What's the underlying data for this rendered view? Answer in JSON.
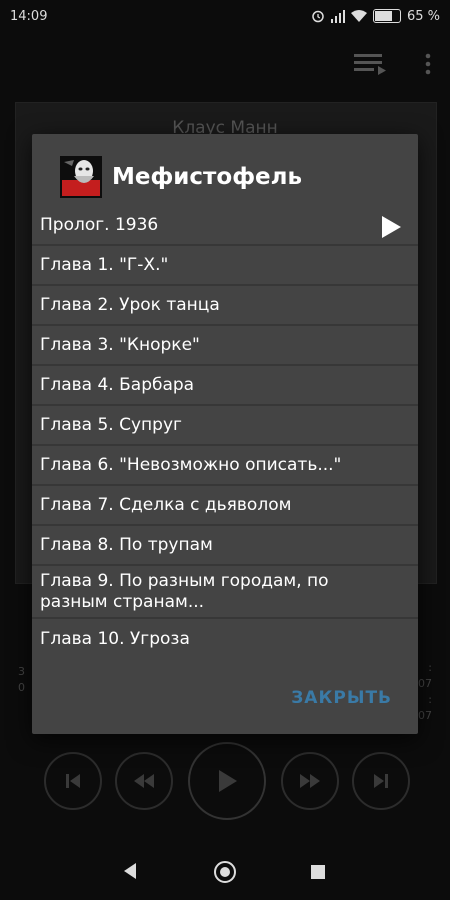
{
  "status_bar": {
    "time": "14:09",
    "battery_text": "65 %",
    "icons": [
      "alarm-icon",
      "signal-icon",
      "wifi-icon",
      "battery-icon"
    ]
  },
  "background": {
    "author": "Клаус Манн",
    "left_time": "3\n0",
    "right_time": ":\n07\n:\n07",
    "toolbar_icons": [
      "playlist-icon",
      "more-icon"
    ],
    "controls": [
      "skip-previous-icon",
      "rewind-icon",
      "play-icon",
      "fast-forward-icon",
      "skip-next-icon"
    ]
  },
  "dialog": {
    "title": "Мефистофель",
    "chapters": [
      "Пролог. 1936",
      "Глава 1. \"Г-Х.\"",
      "Глава 2. Урок танца",
      "Глава 3. \"Кнорке\"",
      "Глава 4. Барбара",
      "Глава 5. Супруг",
      "Глава 6. \"Невозможно описать...\"",
      "Глава 7. Сделка с дьяволом",
      "Глава 8. По трупам",
      "Глава 9. По разным городам, по разным странам...",
      "Глава 10. Угроза"
    ],
    "close_label": "ЗАКРЫТЬ"
  },
  "nav_bar": {
    "buttons": [
      "back-icon",
      "home-icon",
      "recents-icon"
    ]
  },
  "colors": {
    "dialog_bg": "#444444",
    "accent": "#3a7aa6",
    "divider": "#373737"
  }
}
